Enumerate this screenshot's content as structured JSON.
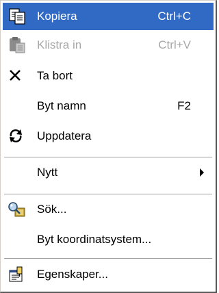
{
  "menu": {
    "items": [
      {
        "label": "Kopiera",
        "shortcut": "Ctrl+C",
        "icon": "copy-icon",
        "state": "selected"
      },
      {
        "label": "Klistra in",
        "shortcut": "Ctrl+V",
        "icon": "paste-icon",
        "state": "disabled"
      },
      {
        "label": "Ta bort",
        "shortcut": "",
        "icon": "delete-icon",
        "state": "normal"
      },
      {
        "label": "Byt namn",
        "shortcut": "F2",
        "icon": "",
        "state": "normal"
      },
      {
        "label": "Uppdatera",
        "shortcut": "",
        "icon": "refresh-icon",
        "state": "normal"
      },
      {
        "label": "Nytt",
        "shortcut": "",
        "icon": "",
        "state": "normal",
        "submenu": true
      },
      {
        "label": "Sök...",
        "shortcut": "",
        "icon": "search-icon",
        "state": "normal"
      },
      {
        "label": "Byt koordinatsystem...",
        "shortcut": "",
        "icon": "",
        "state": "normal"
      },
      {
        "label": "Egenskaper...",
        "shortcut": "",
        "icon": "properties-icon",
        "state": "normal"
      }
    ]
  },
  "colors": {
    "selection": "#316ac5",
    "disabled_text": "#a8a8a8"
  }
}
